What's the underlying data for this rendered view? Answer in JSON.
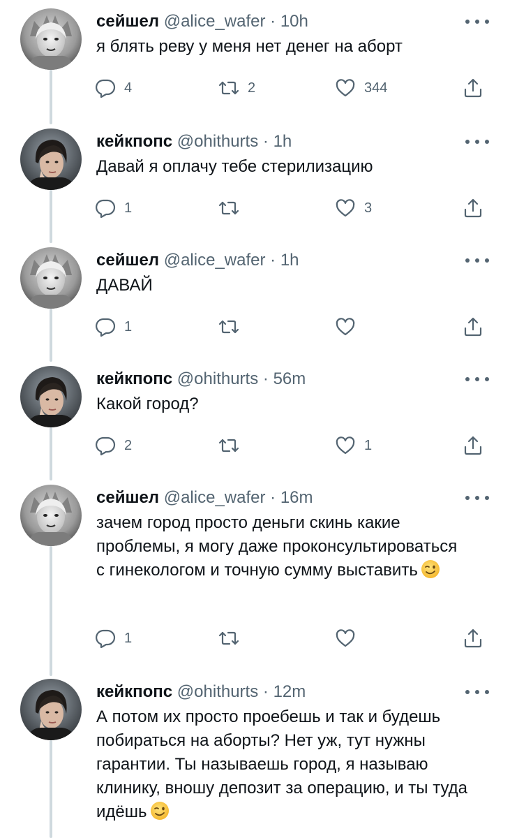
{
  "colors": {
    "text": "#0f1419",
    "secondary": "#536471",
    "thread_line": "#cfd9de"
  },
  "icons": {
    "reply": "speech-bubble-icon",
    "retweet": "retweet-arrows-icon",
    "like": "heart-icon",
    "share": "share-upload-icon",
    "more": "more-dots-icon",
    "emoji": "winking-face-emoji"
  },
  "tweets": [
    {
      "name": "сейшел",
      "handle": "@alice_wafer",
      "separator": "·",
      "time": "10h",
      "text": "я блять реву у меня нет денег на аборт",
      "reply_count": "4",
      "retweet_count": "2",
      "like_count": "344"
    },
    {
      "name": "кейкпопс",
      "handle": "@ohithurts",
      "separator": "·",
      "time": "1h",
      "text": "Давай я оплачу тебе стерилизацию",
      "reply_count": "1",
      "retweet_count": "",
      "like_count": "3"
    },
    {
      "name": "сейшел",
      "handle": "@alice_wafer",
      "separator": "·",
      "time": "1h",
      "text": "ДАВАЙ",
      "reply_count": "1",
      "retweet_count": "",
      "like_count": ""
    },
    {
      "name": "кейкпопс",
      "handle": "@ohithurts",
      "separator": "·",
      "time": "56m",
      "text": "Какой город?",
      "reply_count": "2",
      "retweet_count": "",
      "like_count": "1"
    },
    {
      "name": "сейшел",
      "handle": "@alice_wafer",
      "separator": "·",
      "time": "16m",
      "text": "зачем город просто деньги скинь какие проблемы, я могу даже проконсультироваться с гинекологом и точную сумму выставить",
      "reply_count": "1",
      "retweet_count": "",
      "like_count": ""
    },
    {
      "name": "кейкпопс",
      "handle": "@ohithurts",
      "separator": "·",
      "time": "12m",
      "text": "А потом их просто проебешь и так и будешь побираться на аборты? Нет уж, тут нужны гарантии. Ты называешь город, я называю клинику, вношу депозит за операцию, и ты туда идёшь",
      "reply_count": "",
      "retweet_count": "",
      "like_count": ""
    }
  ]
}
